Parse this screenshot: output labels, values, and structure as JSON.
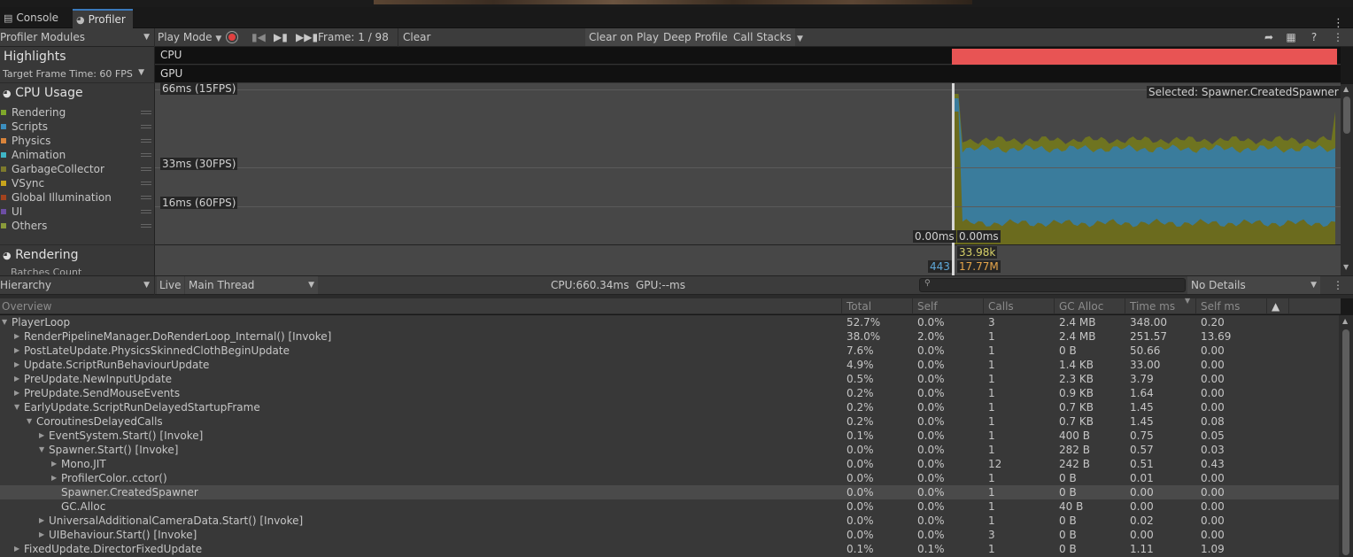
{
  "tabs": [
    {
      "label": "Console",
      "icon": "console-icon"
    },
    {
      "label": "Profiler",
      "icon": "profiler-icon"
    }
  ],
  "toolbar": {
    "modules": "Profiler Modules",
    "play_mode": "Play Mode",
    "frame": "Frame: 1 / 98",
    "clear": "Clear",
    "clear_on_play": "Clear on Play",
    "deep_profile": "Deep Profile",
    "call_stacks": "Call Stacks"
  },
  "highlights": {
    "title": "Highlights",
    "target": "Target Frame Time: 60 FPS",
    "cpu": "CPU",
    "gpu": "GPU"
  },
  "cpu_usage": {
    "title": "CPU Usage",
    "legend": [
      {
        "label": "Rendering",
        "color": "#7fa72b"
      },
      {
        "label": "Scripts",
        "color": "#3c8fbf"
      },
      {
        "label": "Physics",
        "color": "#d9843b"
      },
      {
        "label": "Animation",
        "color": "#3fb5c6"
      },
      {
        "label": "GarbageCollector",
        "color": "#7d7a2c"
      },
      {
        "label": "VSync",
        "color": "#c7a41c"
      },
      {
        "label": "Global Illumination",
        "color": "#a2431e"
      },
      {
        "label": "UI",
        "color": "#6d4ea3"
      },
      {
        "label": "Others",
        "color": "#8a9b3a"
      }
    ]
  },
  "graph": {
    "l66": "66ms (15FPS)",
    "l33": "33ms (30FPS)",
    "l16": "16ms (60FPS)",
    "selected": "Selected: Spawner.CreatedSpawner",
    "t1": "0.00ms",
    "t2": "0.00ms",
    "t3": "33.98k",
    "t4": "443",
    "t5": "17.77M"
  },
  "rendering": {
    "title": "Rendering",
    "sub": "Batches Count"
  },
  "hier": {
    "view": "Hierarchy",
    "live": "Live",
    "thread": "Main Thread",
    "cpu": "CPU:660.34ms",
    "gpu": "GPU:--ms",
    "details": "No Details"
  },
  "columns": {
    "overview": "Overview",
    "total": "Total",
    "self": "Self",
    "calls": "Calls",
    "gc": "GC Alloc",
    "time": "Time ms",
    "selfms": "Self ms"
  },
  "rows": [
    {
      "name": "PlayerLoop",
      "indent": 0,
      "fold": "open",
      "total": "52.7%",
      "self": "0.0%",
      "calls": "3",
      "gc": "2.4 MB",
      "time": "348.00",
      "selfms": "0.20"
    },
    {
      "name": "RenderPipelineManager.DoRenderLoop_Internal() [Invoke]",
      "indent": 1,
      "fold": "closed",
      "total": "38.0%",
      "self": "2.0%",
      "calls": "1",
      "gc": "2.4 MB",
      "time": "251.57",
      "selfms": "13.69"
    },
    {
      "name": "PostLateUpdate.PhysicsSkinnedClothBeginUpdate",
      "indent": 1,
      "fold": "closed",
      "total": "7.6%",
      "self": "0.0%",
      "calls": "1",
      "gc": "0 B",
      "time": "50.66",
      "selfms": "0.00"
    },
    {
      "name": "Update.ScriptRunBehaviourUpdate",
      "indent": 1,
      "fold": "closed",
      "total": "4.9%",
      "self": "0.0%",
      "calls": "1",
      "gc": "1.4 KB",
      "time": "33.00",
      "selfms": "0.00"
    },
    {
      "name": "PreUpdate.NewInputUpdate",
      "indent": 1,
      "fold": "closed",
      "total": "0.5%",
      "self": "0.0%",
      "calls": "1",
      "gc": "2.3 KB",
      "time": "3.79",
      "selfms": "0.00"
    },
    {
      "name": "PreUpdate.SendMouseEvents",
      "indent": 1,
      "fold": "closed",
      "total": "0.2%",
      "self": "0.0%",
      "calls": "1",
      "gc": "0.9 KB",
      "time": "1.64",
      "selfms": "0.00"
    },
    {
      "name": "EarlyUpdate.ScriptRunDelayedStartupFrame",
      "indent": 1,
      "fold": "open",
      "total": "0.2%",
      "self": "0.0%",
      "calls": "1",
      "gc": "0.7 KB",
      "time": "1.45",
      "selfms": "0.00"
    },
    {
      "name": "CoroutinesDelayedCalls",
      "indent": 2,
      "fold": "open",
      "total": "0.2%",
      "self": "0.0%",
      "calls": "1",
      "gc": "0.7 KB",
      "time": "1.45",
      "selfms": "0.08"
    },
    {
      "name": "EventSystem.Start() [Invoke]",
      "indent": 3,
      "fold": "closed",
      "total": "0.1%",
      "self": "0.0%",
      "calls": "1",
      "gc": "400 B",
      "time": "0.75",
      "selfms": "0.05"
    },
    {
      "name": "Spawner.Start() [Invoke]",
      "indent": 3,
      "fold": "open",
      "total": "0.0%",
      "self": "0.0%",
      "calls": "1",
      "gc": "282 B",
      "time": "0.57",
      "selfms": "0.03"
    },
    {
      "name": "Mono.JIT",
      "indent": 4,
      "fold": "closed",
      "total": "0.0%",
      "self": "0.0%",
      "calls": "12",
      "gc": "242 B",
      "time": "0.51",
      "selfms": "0.43"
    },
    {
      "name": "ProfilerColor..cctor()",
      "indent": 4,
      "fold": "closed",
      "total": "0.0%",
      "self": "0.0%",
      "calls": "1",
      "gc": "0 B",
      "time": "0.01",
      "selfms": "0.00"
    },
    {
      "name": "Spawner.CreatedSpawner",
      "indent": 4,
      "fold": "none",
      "selected": true,
      "total": "0.0%",
      "self": "0.0%",
      "calls": "1",
      "gc": "0 B",
      "time": "0.00",
      "selfms": "0.00"
    },
    {
      "name": "GC.Alloc",
      "indent": 4,
      "fold": "none",
      "total": "0.0%",
      "self": "0.0%",
      "calls": "1",
      "gc": "40 B",
      "time": "0.00",
      "selfms": "0.00"
    },
    {
      "name": "UniversalAdditionalCameraData.Start() [Invoke]",
      "indent": 3,
      "fold": "closed",
      "total": "0.0%",
      "self": "0.0%",
      "calls": "1",
      "gc": "0 B",
      "time": "0.02",
      "selfms": "0.00"
    },
    {
      "name": "UIBehaviour.Start() [Invoke]",
      "indent": 3,
      "fold": "closed",
      "total": "0.0%",
      "self": "0.0%",
      "calls": "3",
      "gc": "0 B",
      "time": "0.00",
      "selfms": "0.00"
    },
    {
      "name": "FixedUpdate.DirectorFixedUpdate",
      "indent": 1,
      "fold": "closed",
      "total": "0.1%",
      "self": "0.1%",
      "calls": "1",
      "gc": "0 B",
      "time": "1.11",
      "selfms": "1.09"
    }
  ]
}
